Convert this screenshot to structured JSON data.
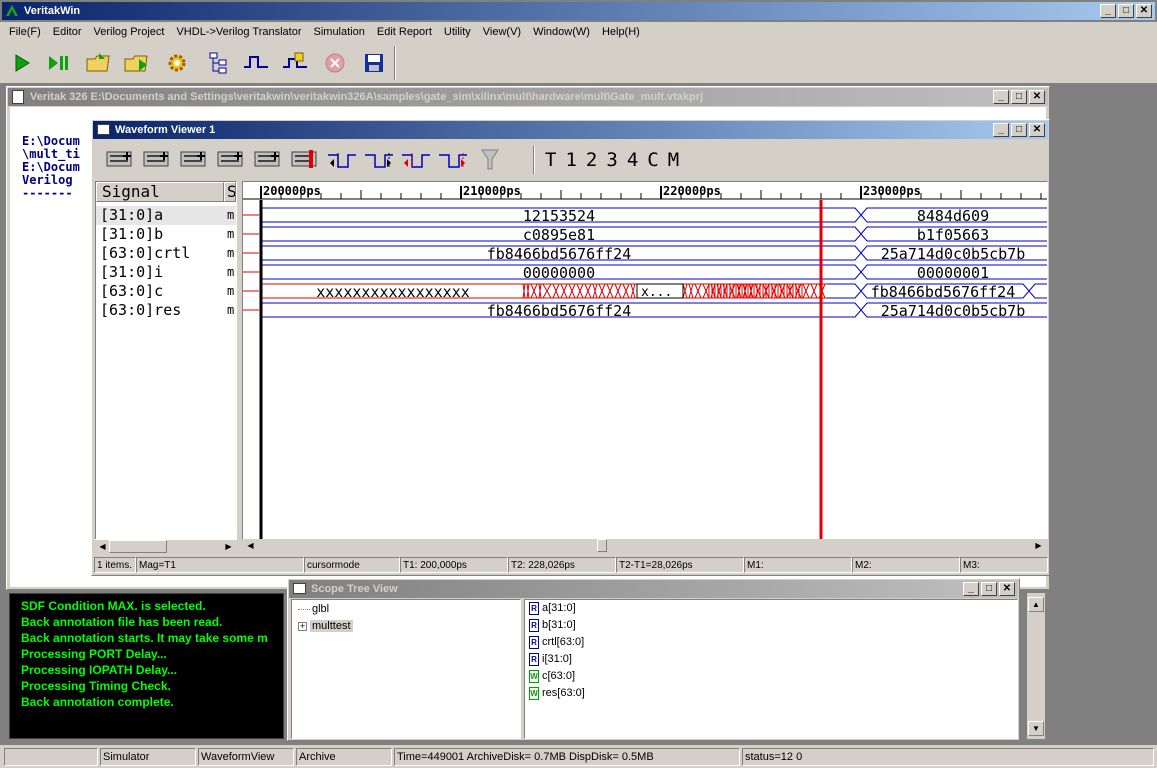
{
  "app": {
    "title": "VeritakWin",
    "menu": [
      "File(F)",
      "Editor",
      "Verilog Project",
      "VHDL->Verilog Translator",
      "Simulation",
      "Edit Report",
      "Utility",
      "View(V)",
      "Window(W)",
      "Help(H)"
    ],
    "toolbar_icons": [
      "run-icon",
      "run-step-icon",
      "open-project-icon",
      "open-folder-icon",
      "compile-gear-icon",
      "hierarchy-icon",
      "waveform-icon",
      "add-module-icon",
      "stop-icon",
      "save-icon"
    ]
  },
  "project_window": {
    "title": "Veritak 326 E:\\Documents and Settings\\veritakwin\\veritakwin326A\\samples\\gate_sim\\xilinx\\mult\\hardware\\mult\\Gate_mult.vtakprj",
    "text_lines": [
      "E:\\Docum",
      "\\mult_ti",
      "E:\\Docum",
      "Verilog",
      "-------"
    ]
  },
  "waveform": {
    "title": "Waveform Viewer 1",
    "tool_letters": [
      "T",
      "1",
      "2",
      "3",
      "4",
      "C",
      "M"
    ],
    "header_signal": "Signal",
    "header_s": "S",
    "time_ticks": [
      "200000ps",
      "210000ps",
      "220000ps",
      "230000ps"
    ],
    "signals": [
      {
        "name": "[31:0]a",
        "mark": "m",
        "value1": "12153524",
        "value2": "8484d609"
      },
      {
        "name": "[31:0]b",
        "mark": "m",
        "value1": "c0895e81",
        "value2": "b1f05663"
      },
      {
        "name": "[63:0]crtl",
        "mark": "m",
        "value1": "fb8466bd5676ff24",
        "value2": "25a714d0c0b5cb7b"
      },
      {
        "name": "[31:0]i",
        "mark": "m",
        "value1": "00000000",
        "value2": "00000001"
      },
      {
        "name": "[63:0]c",
        "mark": "m",
        "value1": "xxxxxxxxxxxxxxxxx",
        "value_mid": "x...",
        "value2": "fb8466bd5676ff24"
      },
      {
        "name": "[63:0]res",
        "mark": "m",
        "value1": "fb8466bd5676ff24",
        "value2": "25a714d0c0b5cb7b"
      }
    ],
    "status": [
      "1 items.",
      "Mag=T1",
      "cursormode",
      "T1: 200,000ps",
      "T2: 228,026ps",
      "T2-T1=28,026ps",
      "M1:",
      "M2:",
      "M3:"
    ],
    "colors": {
      "bus": "#0000c0",
      "cursor": "#e00000",
      "unknown": "#e00000"
    }
  },
  "console": {
    "lines": [
      "SDF Condition MAX. is selected.",
      "Back annotation file has been read.",
      "Back annotation starts. It may take some m",
      "Processing PORT Delay...",
      "Processing IOPATH Delay...",
      "Processing Timing Check.",
      "Back annotation complete."
    ]
  },
  "scope_tree": {
    "title": "Scope Tree View",
    "tree": [
      {
        "label": "glbl",
        "expander": ""
      },
      {
        "label": "multtest",
        "expander": "+"
      }
    ],
    "signals": [
      {
        "label": "a[31:0]",
        "kind": "R"
      },
      {
        "label": "b[31:0]",
        "kind": "R"
      },
      {
        "label": "crtl[63:0]",
        "kind": "R"
      },
      {
        "label": "i[31:0]",
        "kind": "R"
      },
      {
        "label": "c[63:0]",
        "kind": "W"
      },
      {
        "label": "res[63:0]",
        "kind": "W"
      }
    ]
  },
  "statusbar": {
    "cells": [
      "",
      "Simulator",
      "WaveformView",
      "Archive",
      "Time=449001 ArchiveDisk=  0.7MB DispDisk=  0.5MB",
      "status=12 0"
    ]
  }
}
